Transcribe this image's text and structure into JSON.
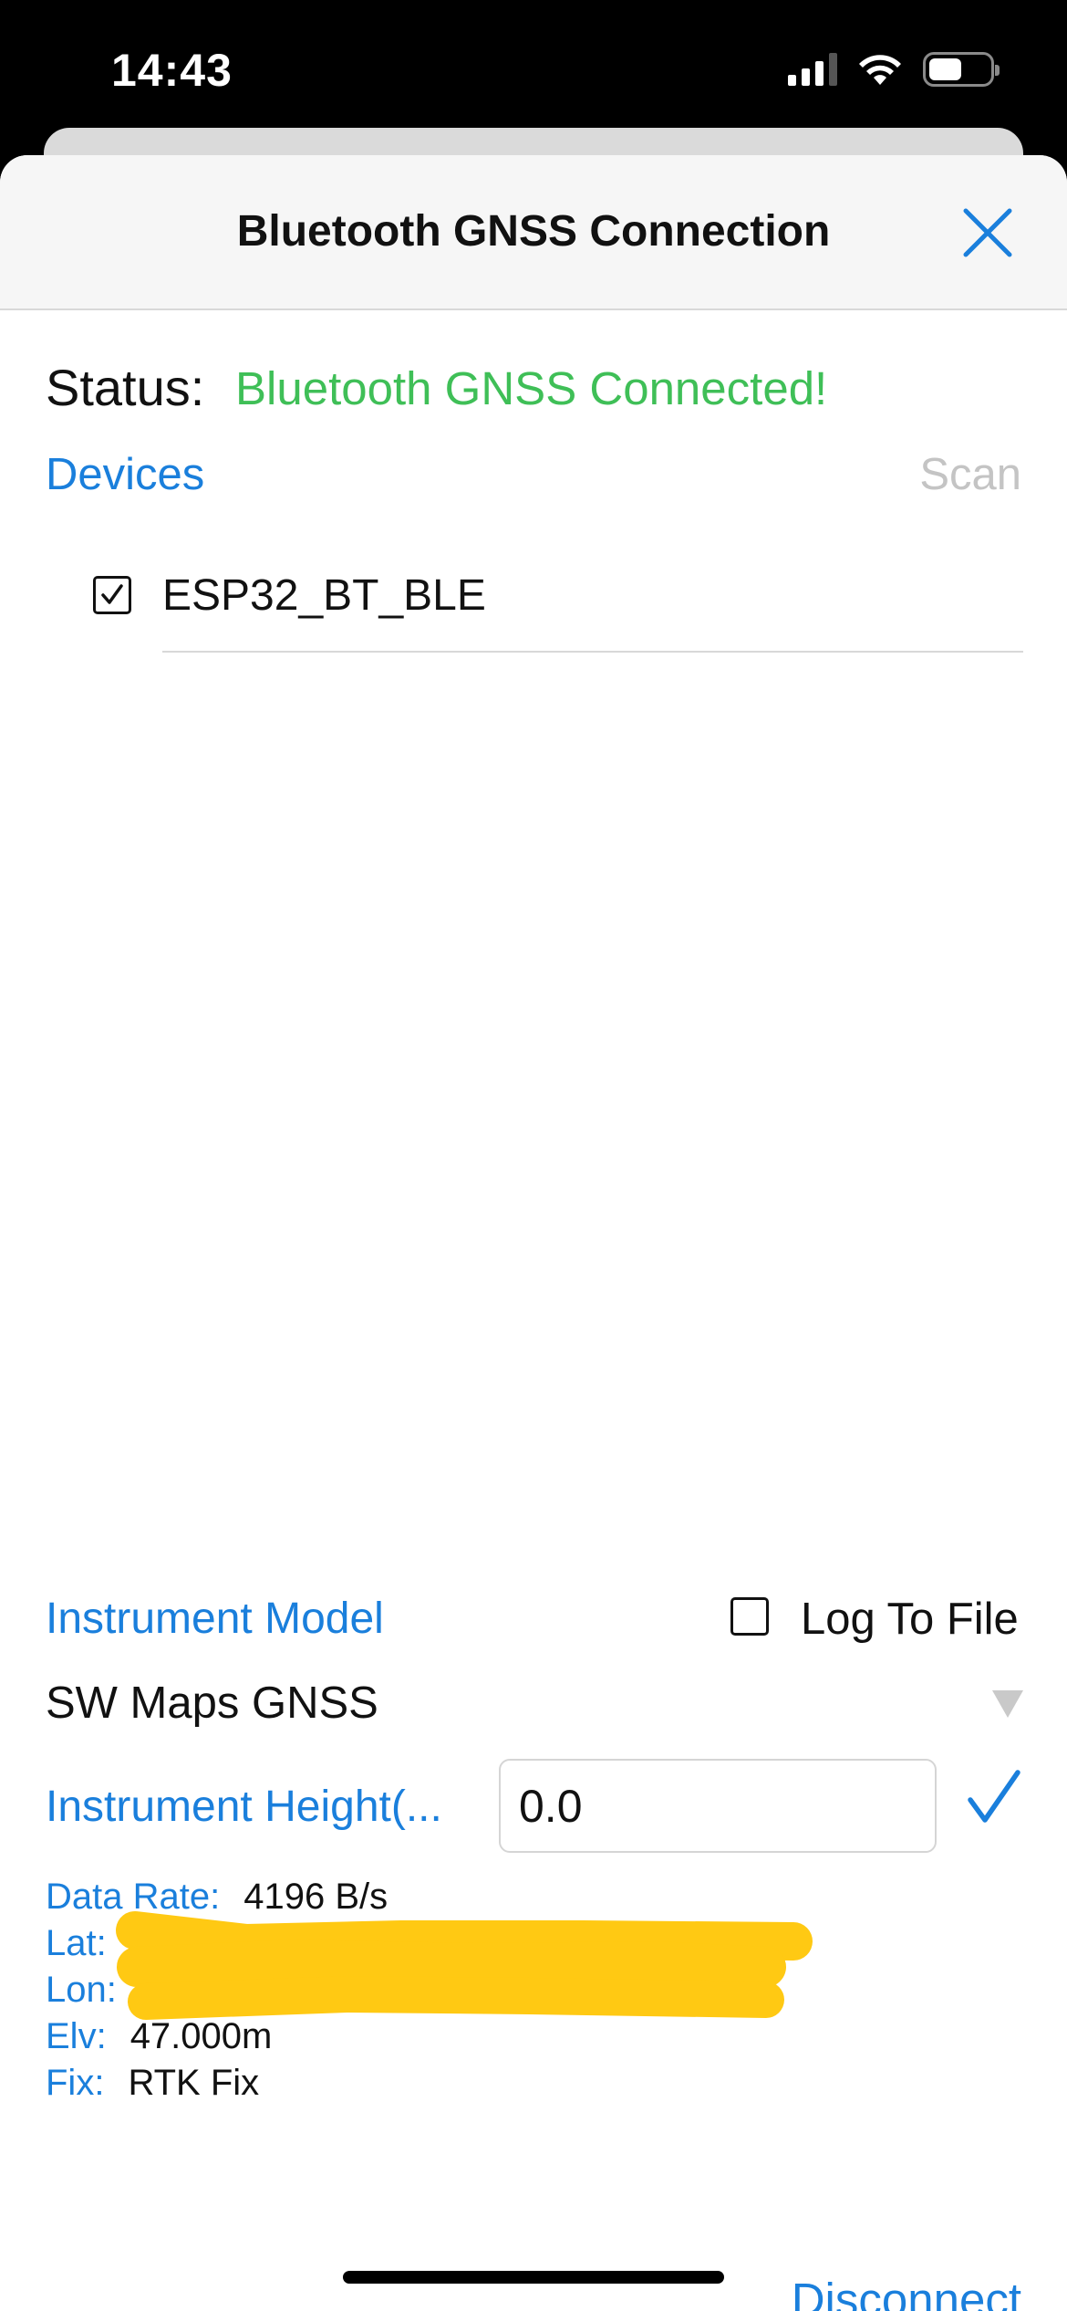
{
  "status_bar": {
    "time": "14:43",
    "signal_icon": "signal-bars-icon",
    "wifi_icon": "wifi-icon",
    "battery_icon": "battery-icon",
    "battery_level": 0.55
  },
  "sheet": {
    "title": "Bluetooth GNSS Connection",
    "close_icon": "close-icon"
  },
  "connection": {
    "status_label": "Status:",
    "status_value": "Bluetooth GNSS Connected!",
    "status_color": "#3fbf57"
  },
  "devices": {
    "header": "Devices",
    "scan_label": "Scan",
    "items": [
      {
        "name": "ESP32_BT_BLE",
        "checked": true
      }
    ]
  },
  "instrument": {
    "model_label": "Instrument Model",
    "log_to_file_label": "Log To File",
    "log_to_file_checked": false,
    "model_value": "SW Maps GNSS",
    "height_label": "Instrument Height(...",
    "height_value": "0.0"
  },
  "readout": {
    "data_rate_label": "Data Rate:",
    "data_rate_value": "4196 B/s",
    "lat_label": "Lat:",
    "lon_label": "Lon:",
    "elv_label": "Elv:",
    "elv_value": "47.000m",
    "fix_label": "Fix:",
    "fix_value": "RTK Fix"
  },
  "actions": {
    "disconnect_label": "Disconnect"
  },
  "colors": {
    "accent": "#1a7fdc",
    "redaction": "#ffc913"
  }
}
